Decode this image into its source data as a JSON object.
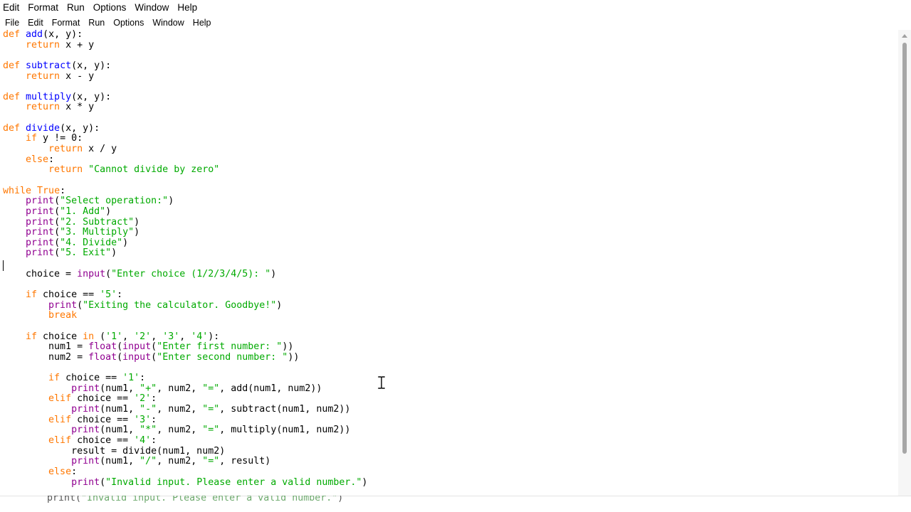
{
  "outer_menu": [
    "Edit",
    "Format",
    "Run",
    "Options",
    "Window",
    "Help"
  ],
  "inner_menu": [
    "File",
    "Edit",
    "Format",
    "Run",
    "Options",
    "Window",
    "Help"
  ],
  "code_lines": [
    [
      [
        "kw",
        "def "
      ],
      [
        "fn",
        "add"
      ],
      [
        "t",
        "(x, y):"
      ]
    ],
    [
      [
        "t",
        "    "
      ],
      [
        "kw",
        "return"
      ],
      [
        "t",
        " x + y"
      ]
    ],
    [],
    [
      [
        "kw",
        "def "
      ],
      [
        "fn",
        "subtract"
      ],
      [
        "t",
        "(x, y):"
      ]
    ],
    [
      [
        "t",
        "    "
      ],
      [
        "kw",
        "return"
      ],
      [
        "t",
        " x - y"
      ]
    ],
    [],
    [
      [
        "kw",
        "def "
      ],
      [
        "fn",
        "multiply"
      ],
      [
        "t",
        "(x, y):"
      ]
    ],
    [
      [
        "t",
        "    "
      ],
      [
        "kw",
        "return"
      ],
      [
        "t",
        " x * y"
      ]
    ],
    [],
    [
      [
        "kw",
        "def "
      ],
      [
        "fn",
        "divide"
      ],
      [
        "t",
        "(x, y):"
      ]
    ],
    [
      [
        "t",
        "    "
      ],
      [
        "kw",
        "if"
      ],
      [
        "t",
        " y != 0:"
      ]
    ],
    [
      [
        "t",
        "        "
      ],
      [
        "kw",
        "return"
      ],
      [
        "t",
        " x / y"
      ]
    ],
    [
      [
        "t",
        "    "
      ],
      [
        "kw",
        "else"
      ],
      [
        "t",
        ":"
      ]
    ],
    [
      [
        "t",
        "        "
      ],
      [
        "kw",
        "return"
      ],
      [
        "t",
        " "
      ],
      [
        "str",
        "\"Cannot divide by zero\""
      ]
    ],
    [],
    [
      [
        "kw",
        "while"
      ],
      [
        "t",
        " "
      ],
      [
        "kw",
        "True"
      ],
      [
        "t",
        ":"
      ]
    ],
    [
      [
        "t",
        "    "
      ],
      [
        "bi",
        "print"
      ],
      [
        "t",
        "("
      ],
      [
        "str",
        "\"Select operation:\""
      ],
      [
        "t",
        ")"
      ]
    ],
    [
      [
        "t",
        "    "
      ],
      [
        "bi",
        "print"
      ],
      [
        "t",
        "("
      ],
      [
        "str",
        "\"1. Add\""
      ],
      [
        "t",
        ")"
      ]
    ],
    [
      [
        "t",
        "    "
      ],
      [
        "bi",
        "print"
      ],
      [
        "t",
        "("
      ],
      [
        "str",
        "\"2. Subtract\""
      ],
      [
        "t",
        ")"
      ]
    ],
    [
      [
        "t",
        "    "
      ],
      [
        "bi",
        "print"
      ],
      [
        "t",
        "("
      ],
      [
        "str",
        "\"3. Multiply\""
      ],
      [
        "t",
        ")"
      ]
    ],
    [
      [
        "t",
        "    "
      ],
      [
        "bi",
        "print"
      ],
      [
        "t",
        "("
      ],
      [
        "str",
        "\"4. Divide\""
      ],
      [
        "t",
        ")"
      ]
    ],
    [
      [
        "t",
        "    "
      ],
      [
        "bi",
        "print"
      ],
      [
        "t",
        "("
      ],
      [
        "str",
        "\"5. Exit\""
      ],
      [
        "t",
        ")"
      ]
    ],
    [],
    [
      [
        "t",
        "    choice = "
      ],
      [
        "bi",
        "input"
      ],
      [
        "t",
        "("
      ],
      [
        "str",
        "\"Enter choice (1/2/3/4/5): \""
      ],
      [
        "t",
        ")"
      ]
    ],
    [],
    [
      [
        "t",
        "    "
      ],
      [
        "kw",
        "if"
      ],
      [
        "t",
        " choice == "
      ],
      [
        "str",
        "'5'"
      ],
      [
        "t",
        ":"
      ]
    ],
    [
      [
        "t",
        "        "
      ],
      [
        "bi",
        "print"
      ],
      [
        "t",
        "("
      ],
      [
        "str",
        "\"Exiting the calculator. Goodbye!\""
      ],
      [
        "t",
        ")"
      ]
    ],
    [
      [
        "t",
        "        "
      ],
      [
        "kw",
        "break"
      ]
    ],
    [],
    [
      [
        "t",
        "    "
      ],
      [
        "kw",
        "if"
      ],
      [
        "t",
        " choice "
      ],
      [
        "kw",
        "in"
      ],
      [
        "t",
        " ("
      ],
      [
        "str",
        "'1'"
      ],
      [
        "t",
        ", "
      ],
      [
        "str",
        "'2'"
      ],
      [
        "t",
        ", "
      ],
      [
        "str",
        "'3'"
      ],
      [
        "t",
        ", "
      ],
      [
        "str",
        "'4'"
      ],
      [
        "t",
        "):"
      ]
    ],
    [
      [
        "t",
        "        num1 = "
      ],
      [
        "bi",
        "float"
      ],
      [
        "t",
        "("
      ],
      [
        "bi",
        "input"
      ],
      [
        "t",
        "("
      ],
      [
        "str",
        "\"Enter first number: \""
      ],
      [
        "t",
        "))"
      ]
    ],
    [
      [
        "t",
        "        num2 = "
      ],
      [
        "bi",
        "float"
      ],
      [
        "t",
        "("
      ],
      [
        "bi",
        "input"
      ],
      [
        "t",
        "("
      ],
      [
        "str",
        "\"Enter second number: \""
      ],
      [
        "t",
        "))"
      ]
    ],
    [],
    [
      [
        "t",
        "        "
      ],
      [
        "kw",
        "if"
      ],
      [
        "t",
        " choice == "
      ],
      [
        "str",
        "'1'"
      ],
      [
        "t",
        ":"
      ]
    ],
    [
      [
        "t",
        "            "
      ],
      [
        "bi",
        "print"
      ],
      [
        "t",
        "(num1, "
      ],
      [
        "str",
        "\"+\""
      ],
      [
        "t",
        ", num2, "
      ],
      [
        "str",
        "\"=\""
      ],
      [
        "t",
        ", add(num1, num2))"
      ]
    ],
    [
      [
        "t",
        "        "
      ],
      [
        "kw",
        "elif"
      ],
      [
        "t",
        " choice == "
      ],
      [
        "str",
        "'2'"
      ],
      [
        "t",
        ":"
      ]
    ],
    [
      [
        "t",
        "            "
      ],
      [
        "bi",
        "print"
      ],
      [
        "t",
        "(num1, "
      ],
      [
        "str",
        "\"-\""
      ],
      [
        "t",
        ", num2, "
      ],
      [
        "str",
        "\"=\""
      ],
      [
        "t",
        ", subtract(num1, num2))"
      ]
    ],
    [
      [
        "t",
        "        "
      ],
      [
        "kw",
        "elif"
      ],
      [
        "t",
        " choice == "
      ],
      [
        "str",
        "'3'"
      ],
      [
        "t",
        ":"
      ]
    ],
    [
      [
        "t",
        "            "
      ],
      [
        "bi",
        "print"
      ],
      [
        "t",
        "(num1, "
      ],
      [
        "str",
        "\"*\""
      ],
      [
        "t",
        ", num2, "
      ],
      [
        "str",
        "\"=\""
      ],
      [
        "t",
        ", multiply(num1, num2))"
      ]
    ],
    [
      [
        "t",
        "        "
      ],
      [
        "kw",
        "elif"
      ],
      [
        "t",
        " choice == "
      ],
      [
        "str",
        "'4'"
      ],
      [
        "t",
        ":"
      ]
    ],
    [
      [
        "t",
        "            result = divide(num1, num2)"
      ]
    ],
    [
      [
        "t",
        "            "
      ],
      [
        "bi",
        "print"
      ],
      [
        "t",
        "(num1, "
      ],
      [
        "str",
        "\"/\""
      ],
      [
        "t",
        ", num2, "
      ],
      [
        "str",
        "\"=\""
      ],
      [
        "t",
        ", result)"
      ]
    ],
    [
      [
        "t",
        "        "
      ],
      [
        "kw",
        "else"
      ],
      [
        "t",
        ":"
      ]
    ],
    [
      [
        "t",
        "            "
      ],
      [
        "bi",
        "print"
      ],
      [
        "t",
        "("
      ],
      [
        "str",
        "\"Invalid input. Please enter a valid number.\""
      ],
      [
        "t",
        ")"
      ]
    ]
  ],
  "ghost_line": [
    [
      "t",
      "print("
    ],
    [
      "str",
      "\"Invalid input. Please enter a valid number.\""
    ],
    [
      "t",
      ")"
    ]
  ],
  "colors": {
    "keyword": "#ff7700",
    "function_def": "#0000ff",
    "builtin": "#900090",
    "string": "#00aa00"
  },
  "icons": {
    "cursor": "i-beam-cursor-icon"
  }
}
